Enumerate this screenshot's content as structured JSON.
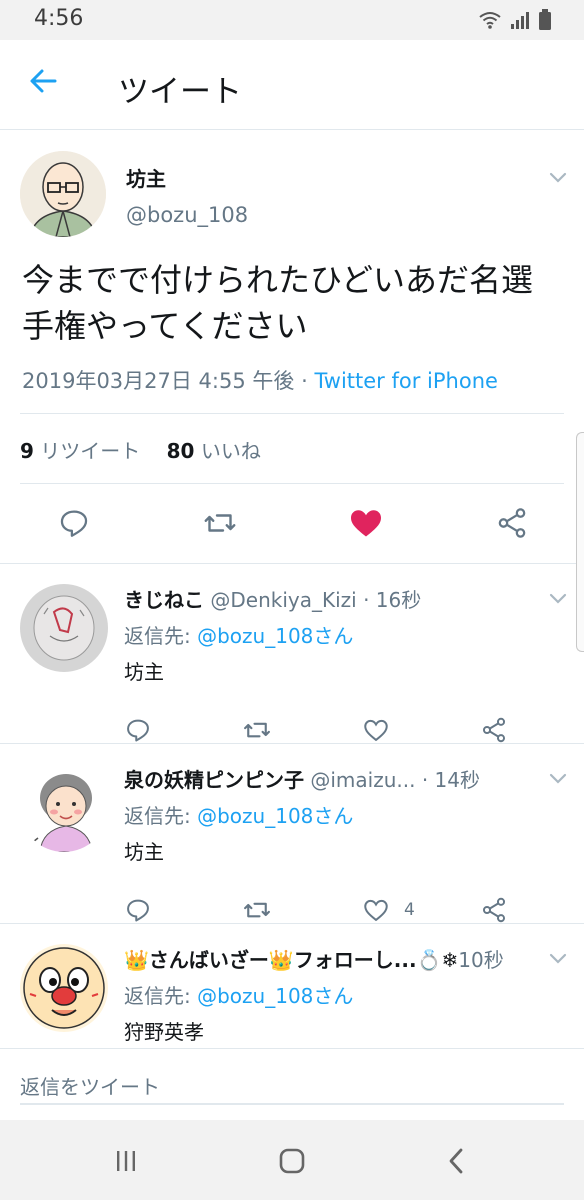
{
  "status_bar": {
    "time": "4:56"
  },
  "header": {
    "title": "ツイート",
    "back_icon": "arrow-left-icon"
  },
  "tweet": {
    "display_name": "坊主",
    "handle": "@bozu_108",
    "text": "今までで付けられたひどいあだ名選手権やってください",
    "timestamp": "2019年03月27日 4:55 午後",
    "separator": " · ",
    "source": "Twitter for iPhone",
    "retweet_count": "9",
    "retweet_label": " リツイート",
    "like_count": "80",
    "like_label": " いいね",
    "liked": true
  },
  "replies": [
    {
      "display_name": "きじねこ",
      "handle": "@Denkiya_Kizi",
      "time": "16秒",
      "replying_label": "返信先: ",
      "replying_to": "@bozu_108さん",
      "text": "坊主",
      "like_count": ""
    },
    {
      "display_name": "泉の妖精ピンピン子",
      "handle": "@imaizu...",
      "time": "14秒",
      "replying_label": "返信先: ",
      "replying_to": "@bozu_108さん",
      "text": "坊主",
      "like_count": "4"
    },
    {
      "display_name": "👑さんばいざー👑フォローし...💍❄",
      "handle": "",
      "time": "10秒",
      "replying_label": "返信先: ",
      "replying_to": "@bozu_108さん",
      "text": "狩野英孝",
      "like_count": ""
    }
  ],
  "reply_input": {
    "placeholder": "返信をツイート"
  },
  "colors": {
    "accent": "#1da1f2",
    "like": "#e0245e",
    "muted": "#657786",
    "text": "#14171a",
    "border": "#e1e8ed"
  }
}
